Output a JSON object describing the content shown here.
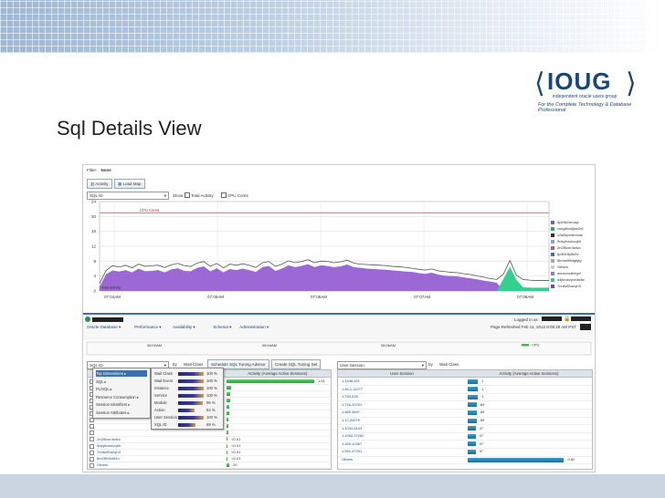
{
  "slide": {
    "title": "Sql Details View",
    "logo": {
      "mark": "IOUG",
      "sub": "independent oracle users group",
      "tagline": "For the Complete Technology & Database Professional"
    }
  },
  "filter": {
    "label": "Filter:",
    "value": "None"
  },
  "toolbar": {
    "activity_label": "Activity",
    "load_map_label": "Load Map"
  },
  "controls": {
    "group_select": "SQL ID",
    "show_label": "Show",
    "total_activity_label": "Total Activity",
    "cpu_cores_label": "CPU Cores"
  },
  "chart_data": {
    "type": "area",
    "y_ticks": [
      "24",
      "20",
      "16",
      "12",
      "8",
      "4",
      "0"
    ],
    "ylim": [
      0,
      24
    ],
    "x_ticks": [
      "07:04AM",
      "07:05AM",
      "07:06AM",
      "07:07AM",
      "07:08AM"
    ],
    "cpu_cores_label": "CPU Cores",
    "cpu_cores": 21,
    "total_activity_label": "Total Activity",
    "grid": true,
    "legend_position": "right",
    "legend": [
      {
        "name": "dj4f4k2oruajz",
        "color": "#7c58c9"
      },
      {
        "name": "cukg8hc6jkw2nf",
        "color": "#2aa876"
      },
      {
        "name": "c2s6kpm6rxxds",
        "color": "#2f2f2f"
      },
      {
        "name": "9nkyforukcq6h",
        "color": "#8fa3c0"
      },
      {
        "name": "2n2f5cnr4wfzc",
        "color": "#b35e7e"
      },
      {
        "name": "fjz3f4r5y5k5v",
        "color": "#3c6fb3"
      },
      {
        "name": "8bmm5ftdgbjtg",
        "color": "#a8a8a8"
      },
      {
        "name": "Others",
        "color": "#cfcfcf"
      },
      {
        "name": "aduuvxc8ntgcf",
        "color": "#9a7ad0"
      },
      {
        "name": "d4jkrsbzpnb8xfw",
        "color": "#35d08f"
      },
      {
        "name": "7nn6zf2wnyh3",
        "color": "#6b4bc2"
      }
    ],
    "series": [
      {
        "name": "Total Activity",
        "color": "#555555",
        "x": [
          0,
          1,
          2,
          3,
          4,
          5,
          6,
          7,
          8,
          9,
          10,
          11,
          12,
          13,
          14,
          15,
          16,
          17,
          18,
          19,
          20,
          21,
          22,
          23,
          24,
          25,
          26,
          27,
          28,
          29,
          30,
          31,
          32,
          33,
          34,
          35,
          36,
          37,
          38,
          39,
          40,
          41,
          42,
          43,
          44,
          45,
          46,
          47,
          48,
          49,
          50,
          51,
          52,
          53,
          54,
          55,
          56,
          57,
          58,
          59,
          60,
          61,
          62,
          63,
          64,
          65,
          66,
          67,
          68,
          69
        ],
        "values": [
          2.0,
          5.5,
          6.8,
          6.4,
          6.9,
          6.2,
          7.2,
          6.6,
          6.8,
          6.9,
          6.3,
          7.0,
          7.4,
          6.8,
          6.6,
          7.5,
          7.9,
          6.6,
          7.4,
          6.2,
          7.2,
          6.9,
          7.3,
          6.9,
          6.3,
          7.6,
          7.9,
          6.6,
          7.2,
          8.1,
          7.6,
          7.9,
          8.4,
          7.6,
          8.0,
          7.9,
          7.6,
          7.8,
          8.3,
          7.5,
          7.2,
          7.1,
          7.0,
          6.9,
          6.8,
          6.6,
          6.5,
          6.3,
          6.1,
          5.8,
          5.6,
          5.9,
          5.4,
          5.2,
          5.0,
          4.9,
          4.6,
          4.4,
          4.0,
          3.7,
          3.3,
          3.1,
          4.5,
          8.2,
          4.2,
          3.1,
          2.9,
          2.8,
          2.8,
          2.8
        ]
      },
      {
        "name": "dj4f4k2oruajz",
        "color": "#9b68d6",
        "x": [
          0,
          1,
          2,
          3,
          4,
          5,
          6,
          7,
          8,
          9,
          10,
          11,
          12,
          13,
          14,
          15,
          16,
          17,
          18,
          19,
          20,
          21,
          22,
          23,
          24,
          25,
          26,
          27,
          28,
          29,
          30,
          31,
          32,
          33,
          34,
          35,
          36,
          37,
          38,
          39,
          40,
          41,
          42,
          43,
          44,
          45,
          46,
          47,
          48,
          49,
          50,
          51,
          52,
          53,
          54,
          55,
          56,
          57,
          58,
          59,
          60,
          61,
          62,
          63,
          64,
          65,
          66,
          67,
          68,
          69
        ],
        "values": [
          1.2,
          4.5,
          5.5,
          5.2,
          5.6,
          5.0,
          6.0,
          5.3,
          5.4,
          5.6,
          5.0,
          5.8,
          6.1,
          5.4,
          5.3,
          6.2,
          6.6,
          5.3,
          6.1,
          5.0,
          5.9,
          5.6,
          6.0,
          5.6,
          5.1,
          6.4,
          6.7,
          5.4,
          6.0,
          6.9,
          6.4,
          6.7,
          7.2,
          6.4,
          6.9,
          6.7,
          6.4,
          6.6,
          7.1,
          6.4,
          6.2,
          6.0,
          5.9,
          5.8,
          5.7,
          5.5,
          5.4,
          5.2,
          5.1,
          4.8,
          4.6,
          4.9,
          4.4,
          4.1,
          4.0,
          3.9,
          3.6,
          3.4,
          3.1,
          2.8,
          2.5,
          2.2,
          0,
          0,
          0,
          0,
          0,
          0,
          0,
          0
        ]
      },
      {
        "name": "d4jkrsbzpnb8xfw",
        "color": "#35d08f",
        "x": [
          61,
          62,
          63,
          64,
          65,
          66,
          67,
          68,
          69
        ],
        "values": [
          0,
          3.2,
          6.5,
          3.0,
          1.0,
          0.9,
          0.9,
          0.9,
          0.9
        ]
      }
    ]
  },
  "oem_header": {
    "menus": [
      "Oracle Database ▾",
      "Performance ▾",
      "Availability ▾",
      "Schema ▾",
      "Administration ▾"
    ],
    "logged_in": "Logged in as",
    "refreshed": "Page Refreshed Feb 11, 2012 8:08:29 AM PST",
    "mini_ticks": [
      "08:02AM",
      "08:04AM",
      "08:06AM"
    ],
    "cpu_label": "CPU"
  },
  "left_panel": {
    "dim_select": "SQL ID",
    "by_label": "by",
    "by_value": "Wait Class",
    "button1": "Schedule SQL Tuning Advisor",
    "button2": "Create SQL Tuning Set",
    "col_activity": "Activity (Average Active Sessions)",
    "rows": [
      {
        "id": "",
        "val": "1.61",
        "w": 0.96
      },
      {
        "id": "",
        "val": "",
        "w": 0.05
      },
      {
        "id": "",
        "val": "",
        "w": 0.04
      },
      {
        "id": "",
        "val": "",
        "w": 0.035
      },
      {
        "id": "",
        "val": "",
        "w": 0.03
      },
      {
        "id": "",
        "val": "",
        "w": 0.025
      },
      {
        "id": "",
        "val": "",
        "w": 0.02
      },
      {
        "id": "",
        "val": "",
        "w": 0.02
      },
      {
        "id": "",
        "val": "",
        "w": 0.015
      },
      {
        "id": "2n2f5cnr4wfzc",
        "val": "<0.01",
        "w": 0.012
      },
      {
        "id": "9nkyforukcq6h",
        "val": "<0.01",
        "w": 0.012
      },
      {
        "id": "7nn6zf2wnyh3",
        "val": "<0.01",
        "w": 0.012
      },
      {
        "id": "8m2f5r5v8r4n",
        "val": "<0.01",
        "w": 0.012
      },
      {
        "id": "Others",
        "val": "20",
        "w": 0.03
      }
    ]
  },
  "context_menu": {
    "items": [
      "Top Dimensions",
      "SQL",
      "PL/SQL",
      "Resource Consumption",
      "Session Identifiers",
      "Session Attributes"
    ],
    "sub_items": [
      {
        "label": "Wait Class",
        "pct": "100 %"
      },
      {
        "label": "Wait Event",
        "pct": "100 %"
      },
      {
        "label": "Instance",
        "pct": "100 %"
      },
      {
        "label": "Service",
        "pct": "100 %"
      },
      {
        "label": "Module",
        "pct": "95 %"
      },
      {
        "label": "Action",
        "pct": "64 %"
      },
      {
        "label": "User Session",
        "pct": "100 %"
      },
      {
        "label": "SQL ID",
        "pct": "69 %"
      }
    ]
  },
  "right_panel": {
    "dim_select": "User Session",
    "by_label": "by",
    "by_value": "Wait Class",
    "col_session": "User Session",
    "col_activity": "Activity (Average Active Sessions)",
    "rows": [
      {
        "session": "1,1646,821",
        "val": "1",
        "w": 0.09
      },
      {
        "session": "1,46,1,11077",
        "val": "1",
        "w": 0.09
      },
      {
        "session": "1,750,526",
        "val": "1",
        "w": 0.09
      },
      {
        "session": "1,716,20701",
        "val": "69",
        "w": 0.08
      },
      {
        "session": "1,665,4697",
        "val": "69",
        "w": 0.08
      },
      {
        "session": "1,12,20079",
        "val": "69",
        "w": 0.08
      },
      {
        "session": "1,1034,6103",
        "val": "37",
        "w": 0.07
      },
      {
        "session": "1,1052,27260",
        "val": "97",
        "w": 0.07
      },
      {
        "session": "1,269,12067",
        "val": "97",
        "w": 0.07
      },
      {
        "session": "1,551,47291",
        "val": "97",
        "w": 0.07
      },
      {
        "session": "Others",
        "val": "0.82",
        "w": 0.85
      }
    ]
  }
}
